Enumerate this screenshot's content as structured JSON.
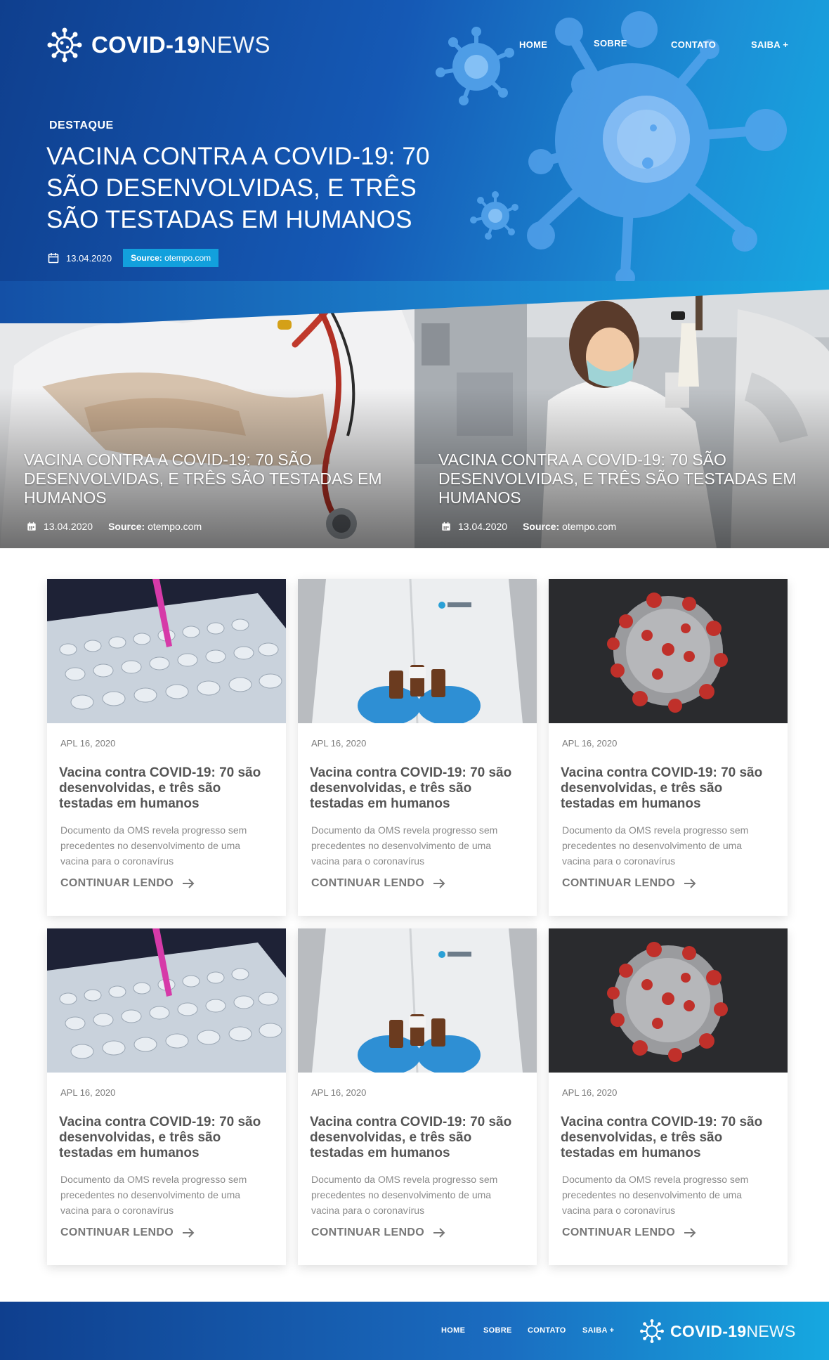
{
  "brand": {
    "name_bold": "COVID-19",
    "name_light": "NEWS"
  },
  "nav": {
    "items": [
      "HOME",
      "SOBRE",
      "CONTATO",
      "SAIBA +"
    ]
  },
  "hero": {
    "kicker": "DESTAQUE",
    "title": "VACINA CONTRA A COVID-19: 70 SÃO DESENVOLVIDAS, E TRÊS SÃO TESTADAS EM HUMANOS",
    "date": "13.04.2020",
    "source_label": "Source:",
    "source_value": "otempo.com"
  },
  "featured": [
    {
      "title": "VACINA CONTRA A COVID-19: 70 SÃO DESENVOLVIDAS, E TRÊS SÃO TESTADAS EM HUMANOS",
      "date": "13.04.2020",
      "source_label": "Source:",
      "source_value": "otempo.com"
    },
    {
      "title": "VACINA CONTRA A COVID-19: 70 SÃO DESENVOLVIDAS, E TRÊS SÃO TESTADAS EM HUMANOS",
      "date": "13.04.2020",
      "source_label": "Source:",
      "source_value": "otempo.com"
    }
  ],
  "cards": [
    {
      "image": "test-tubes",
      "date": "APL 16, 2020",
      "title": "Vacina contra COVID-19: 70 são desenvolvidas, e três são testadas em humanos",
      "excerpt": "Documento da OMS revela progresso sem precedentes no desenvolvimento de uma vacina para o coronavírus",
      "more": "CONTINUAR LENDO"
    },
    {
      "image": "lab-coat-vials",
      "date": "APL 16, 2020",
      "title": "Vacina contra COVID-19: 70 são desenvolvidas, e três são testadas em humanos",
      "excerpt": "Documento da OMS revela progresso sem precedentes no desenvolvimento de uma vacina para o coronavírus",
      "more": "CONTINUAR LENDO"
    },
    {
      "image": "coronavirus",
      "date": "APL 16, 2020",
      "title": "Vacina contra COVID-19: 70 são desenvolvidas, e três são testadas em humanos",
      "excerpt": "Documento da OMS revela progresso sem precedentes no desenvolvimento de uma vacina para o coronavírus",
      "more": "CONTINUAR LENDO"
    },
    {
      "image": "test-tubes",
      "date": "APL 16, 2020",
      "title": "Vacina contra COVID-19: 70 são desenvolvidas, e três são testadas em humanos",
      "excerpt": "Documento da OMS revela progresso sem precedentes no desenvolvimento de uma vacina para o coronavírus",
      "more": "CONTINUAR LENDO"
    },
    {
      "image": "lab-coat-vials",
      "date": "APL 16, 2020",
      "title": "Vacina contra COVID-19: 70 são desenvolvidas, e três são testadas em humanos",
      "excerpt": "Documento da OMS revela progresso sem precedentes no desenvolvimento de uma vacina para o coronavírus",
      "more": "CONTINUAR LENDO"
    },
    {
      "image": "coronavirus",
      "date": "APL 16, 2020",
      "title": "Vacina contra COVID-19: 70 são desenvolvidas, e três são testadas em humanos",
      "excerpt": "Documento da OMS revela progresso sem precedentes no desenvolvimento de uma vacina para o coronavírus",
      "more": "CONTINUAR LENDO"
    }
  ],
  "footer": {
    "nav": [
      "HOME",
      "SOBRE",
      "CONTATO",
      "SAIBA +"
    ]
  },
  "colors": {
    "brand_dark": "#0f3f8e",
    "brand_light": "#16a8e0",
    "badge": "#12a0dd"
  },
  "icons": {
    "logo": "virus-icon",
    "date": "calendar-icon",
    "more": "arrow-right-icon"
  }
}
